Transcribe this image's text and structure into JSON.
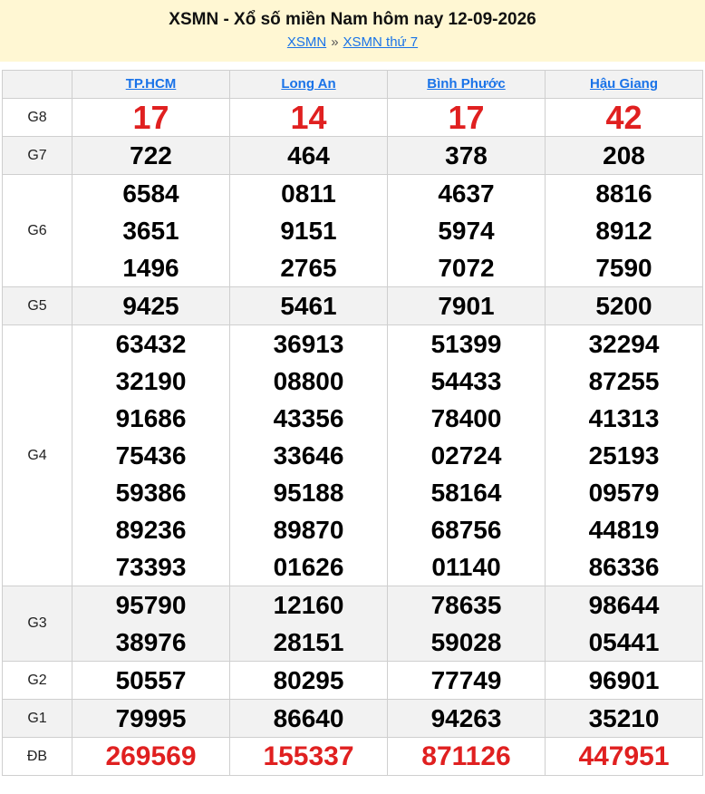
{
  "header": {
    "title": "XSMN - Xổ số miền Nam hôm nay 12-09-2026",
    "breadcrumb": [
      "XSMN",
      "XSMN thứ 7"
    ],
    "separator": "»"
  },
  "provinces": [
    "TP.HCM",
    "Long An",
    "Bình Phước",
    "Hậu Giang"
  ],
  "prizes": [
    {
      "label": "G8",
      "values": [
        [
          "17"
        ],
        [
          "14"
        ],
        [
          "17"
        ],
        [
          "42"
        ]
      ]
    },
    {
      "label": "G7",
      "values": [
        [
          "722"
        ],
        [
          "464"
        ],
        [
          "378"
        ],
        [
          "208"
        ]
      ]
    },
    {
      "label": "G6",
      "values": [
        [
          "6584",
          "3651",
          "1496"
        ],
        [
          "0811",
          "9151",
          "2765"
        ],
        [
          "4637",
          "5974",
          "7072"
        ],
        [
          "8816",
          "8912",
          "7590"
        ]
      ]
    },
    {
      "label": "G5",
      "values": [
        [
          "9425"
        ],
        [
          "5461"
        ],
        [
          "7901"
        ],
        [
          "5200"
        ]
      ]
    },
    {
      "label": "G4",
      "values": [
        [
          "63432",
          "32190",
          "91686",
          "75436",
          "59386",
          "89236",
          "73393"
        ],
        [
          "36913",
          "08800",
          "43356",
          "33646",
          "95188",
          "89870",
          "01626"
        ],
        [
          "51399",
          "54433",
          "78400",
          "02724",
          "58164",
          "68756",
          "01140"
        ],
        [
          "32294",
          "87255",
          "41313",
          "25193",
          "09579",
          "44819",
          "86336"
        ]
      ]
    },
    {
      "label": "G3",
      "values": [
        [
          "95790",
          "38976"
        ],
        [
          "12160",
          "28151"
        ],
        [
          "78635",
          "59028"
        ],
        [
          "98644",
          "05441"
        ]
      ]
    },
    {
      "label": "G2",
      "values": [
        [
          "50557"
        ],
        [
          "80295"
        ],
        [
          "77749"
        ],
        [
          "96901"
        ]
      ]
    },
    {
      "label": "G1",
      "values": [
        [
          "79995"
        ],
        [
          "86640"
        ],
        [
          "94263"
        ],
        [
          "35210"
        ]
      ]
    },
    {
      "label": "ĐB",
      "values": [
        [
          "269569"
        ],
        [
          "155337"
        ],
        [
          "871126"
        ],
        [
          "447951"
        ]
      ]
    }
  ],
  "colors": {
    "header_bg": "#fff7d3",
    "link": "#1a73e8",
    "special": "#e02020",
    "stripe": "#f2f2f2"
  }
}
